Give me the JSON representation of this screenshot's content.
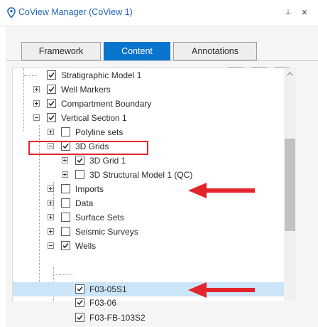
{
  "window": {
    "title": "CoView Manager (CoView 1)",
    "icon": "map-pin-icon",
    "pin_glyph": "⊥",
    "close_glyph": "×"
  },
  "tabs": [
    {
      "label": "Framework",
      "active": false
    },
    {
      "label": "Content",
      "active": true
    },
    {
      "label": "Annotations",
      "active": false
    }
  ],
  "toolbar": {
    "buttons": [
      "filter-list-icon",
      "move-up-icon",
      "move-down-icon"
    ]
  },
  "tree": {
    "items": [
      {
        "label": "Stratigraphic Model 1",
        "checked": true,
        "expander": "none",
        "selected": false
      },
      {
        "label": "Well Markers",
        "checked": true,
        "expander": "plus",
        "selected": false
      },
      {
        "label": "Compartment Boundary",
        "checked": true,
        "expander": "plus",
        "selected": false
      },
      {
        "label": "Vertical Section 1",
        "checked": true,
        "expander": "minus",
        "selected": false,
        "highlighted": true
      },
      {
        "label": "Polyline sets",
        "checked": false,
        "expander": "plus",
        "selected": false
      },
      {
        "label": "3D Grids",
        "checked": true,
        "expander": "minus",
        "selected": false
      },
      {
        "label": "3D Grid 1",
        "checked": true,
        "expander": "plus",
        "selected": false,
        "arrow": true
      },
      {
        "label": "3D Structural Model 1 (QC)",
        "checked": false,
        "expander": "plus",
        "selected": false
      },
      {
        "label": "Imports",
        "checked": false,
        "expander": "plus",
        "selected": false
      },
      {
        "label": "Data",
        "checked": false,
        "expander": "plus",
        "selected": false
      },
      {
        "label": "Surface Sets",
        "checked": false,
        "expander": "plus",
        "selected": false
      },
      {
        "label": "Seismic Surveys",
        "checked": false,
        "expander": "plus",
        "selected": false
      },
      {
        "label": "Wells",
        "checked": true,
        "expander": "minus",
        "selected": false
      },
      {
        "label": "F03-05S1",
        "checked": true,
        "expander": "none",
        "selected": true,
        "arrow": true
      },
      {
        "label": "F03-06",
        "checked": true,
        "expander": "none",
        "selected": false
      },
      {
        "label": "F03-FB-103S2",
        "checked": true,
        "expander": "none",
        "selected": false
      }
    ]
  },
  "colors": {
    "accent": "#0a74cf",
    "title_text": "#1e63b8",
    "annotation_red": "#e3242b",
    "selection": "#cce4f7"
  }
}
